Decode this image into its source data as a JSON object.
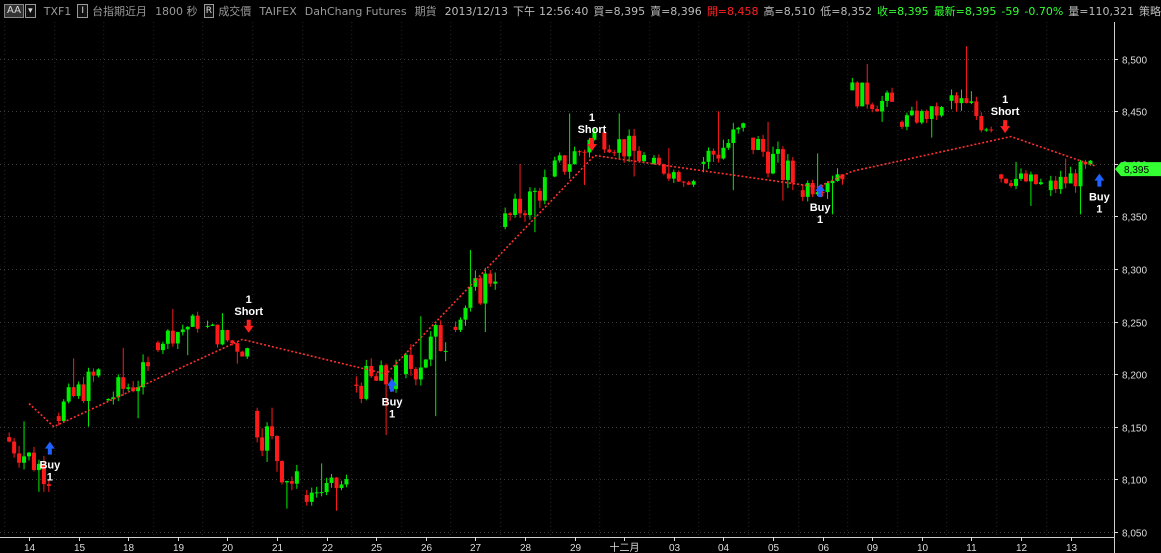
{
  "toolbar": {
    "aa_label": "AA",
    "symbol": "TXF1",
    "ind_icon": "I",
    "name": "台指期近月",
    "interval": "1800 秒",
    "r_icon": "R",
    "price_type": "成交價",
    "exchange": "TAIFEX",
    "broker": "DahChang Futures",
    "market": "期貨",
    "date": "2013/12/13",
    "ampm": "下午",
    "time": "12:56:40",
    "bid": "買=8,395",
    "ask": "賣=8,396",
    "open": "開=8,458",
    "high": "高=8,510",
    "low": "低=8,352",
    "close": "收=8,395",
    "last": "最新=8,395",
    "change": "-59",
    "change_pct": "-0.70%",
    "volume": "量=110,321",
    "strategy": "策略",
    "colors": {
      "down": "#ff2020",
      "up": "#33ff33",
      "neutral": "#cccccc"
    }
  },
  "chart_data": {
    "type": "candlestick",
    "ylim": [
      8045,
      8535
    ],
    "y_ticks": [
      8050,
      8100,
      8150,
      8200,
      8250,
      8300,
      8350,
      8400,
      8450,
      8500
    ],
    "y_tick_labels": [
      "8,050",
      "8,100",
      "8,150",
      "8,200",
      "8,250",
      "8,300",
      "8,350",
      "8,400",
      "8,450",
      "8,500"
    ],
    "x_labels": [
      "14",
      "15",
      "18",
      "19",
      "20",
      "21",
      "22",
      "25",
      "26",
      "27",
      "28",
      "29",
      "十二月",
      "03",
      "04",
      "05",
      "06",
      "09",
      "10",
      "11",
      "12",
      "13"
    ],
    "last_price": 8395,
    "last_price_label": "8,395",
    "day_anchors": [
      {
        "o": 8140,
        "c": 8105,
        "h": 8155,
        "l": 8088
      },
      {
        "o": 8160,
        "c": 8200,
        "h": 8215,
        "l": 8150
      },
      {
        "o": 8175,
        "c": 8200,
        "h": 8225,
        "l": 8158
      },
      {
        "o": 8230,
        "c": 8250,
        "h": 8262,
        "l": 8218
      },
      {
        "o": 8245,
        "c": 8222,
        "h": 8258,
        "l": 8210
      },
      {
        "o": 8165,
        "c": 8090,
        "h": 8168,
        "l": 8072
      },
      {
        "o": 8085,
        "c": 8095,
        "h": 8115,
        "l": 8070
      },
      {
        "o": 8190,
        "c": 8195,
        "h": 8215,
        "l": 8142
      },
      {
        "o": 8200,
        "c": 8238,
        "h": 8255,
        "l": 8160
      },
      {
        "o": 8245,
        "c": 8300,
        "h": 8318,
        "l": 8240
      },
      {
        "o": 8340,
        "c": 8380,
        "h": 8400,
        "l": 8335
      },
      {
        "o": 8388,
        "c": 8425,
        "h": 8448,
        "l": 8380
      },
      {
        "o": 8430,
        "c": 8405,
        "h": 8448,
        "l": 8388
      },
      {
        "o": 8400,
        "c": 8385,
        "h": 8415,
        "l": 8378
      },
      {
        "o": 8400,
        "c": 8430,
        "h": 8450,
        "l": 8375
      },
      {
        "o": 8425,
        "c": 8385,
        "h": 8440,
        "l": 8365
      },
      {
        "o": 8375,
        "c": 8395,
        "h": 8410,
        "l": 8352
      },
      {
        "o": 8470,
        "c": 8455,
        "h": 8495,
        "l": 8440
      },
      {
        "o": 8440,
        "c": 8450,
        "h": 8460,
        "l": 8425
      },
      {
        "o": 8460,
        "c": 8440,
        "h": 8512,
        "l": 8430
      },
      {
        "o": 8390,
        "c": 8380,
        "h": 8402,
        "l": 8360
      },
      {
        "o": 8375,
        "c": 8395,
        "h": 8405,
        "l": 8352
      }
    ],
    "trade_line": [
      {
        "x": 0.0,
        "y": 8172
      },
      {
        "x": 0.5,
        "y": 8150
      },
      {
        "x": 4.3,
        "y": 8233
      },
      {
        "x": 7.2,
        "y": 8200
      },
      {
        "x": 11.4,
        "y": 8408
      },
      {
        "x": 15.9,
        "y": 8378
      },
      {
        "x": 16.6,
        "y": 8393
      },
      {
        "x": 19.8,
        "y": 8426
      },
      {
        "x": 21.5,
        "y": 8398
      }
    ],
    "signals": [
      {
        "type": "buy",
        "x": 0.42,
        "price": 8130,
        "label": "Buy",
        "qty": "1"
      },
      {
        "type": "short",
        "x": 4.43,
        "price": 8245,
        "label": "Short",
        "qty": "1"
      },
      {
        "type": "buy",
        "x": 7.32,
        "price": 8190,
        "label": "Buy",
        "qty": "1"
      },
      {
        "type": "short",
        "x": 11.35,
        "price": 8418,
        "label": "Short",
        "qty": "1"
      },
      {
        "type": "buy",
        "x": 15.95,
        "price": 8375,
        "label": "Buy",
        "qty": "1"
      },
      {
        "type": "short",
        "x": 19.68,
        "price": 8435,
        "label": "Short",
        "qty": "1"
      },
      {
        "type": "buy",
        "x": 21.58,
        "price": 8385,
        "label": "Buy",
        "qty": "1"
      }
    ],
    "colors": {
      "up": "#00ee00",
      "down": "#ff1a1a",
      "trade_line": "#ff3030",
      "buy_arrow": "#2060ff",
      "short_arrow": "#ff2020",
      "last_price_bg": "#33ff33",
      "axis": "#dddddd"
    }
  }
}
